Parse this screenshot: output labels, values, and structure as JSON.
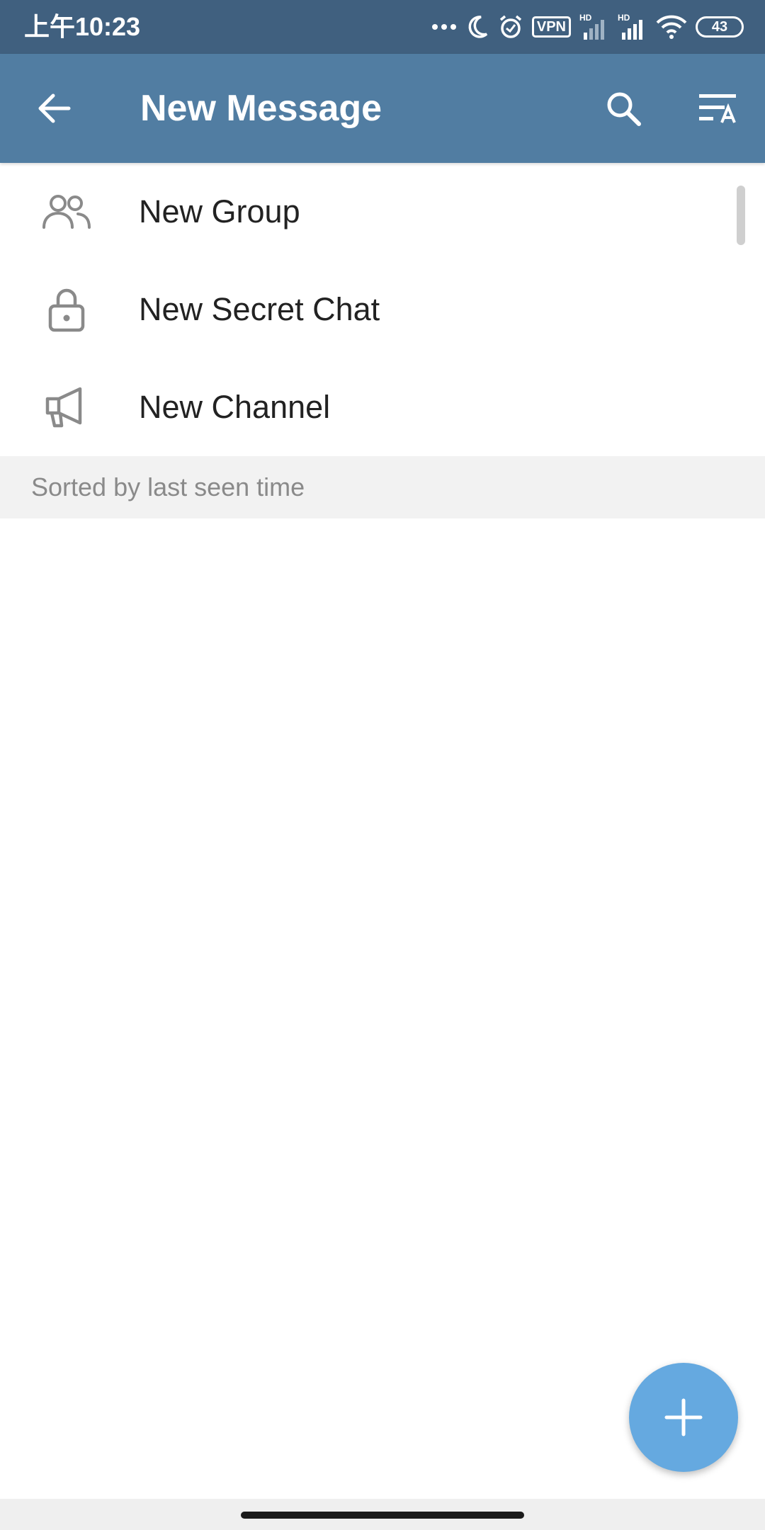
{
  "status_bar": {
    "time": "上午10:23",
    "vpn_label": "VPN",
    "signal_badge_1": "HD",
    "signal_badge_2": "HD",
    "battery_level": "43",
    "icons": [
      "more-dots-icon",
      "moon-icon",
      "alarm-icon",
      "vpn-icon",
      "signal-hd-icon",
      "signal-hd-icon",
      "wifi-icon",
      "battery-icon"
    ]
  },
  "app_bar": {
    "title": "New Message",
    "back_icon": "arrow-left-icon",
    "search_icon": "search-icon",
    "sort_icon": "sort-alpha-icon"
  },
  "actions": [
    {
      "label": "New Group",
      "icon": "group-icon"
    },
    {
      "label": "New Secret Chat",
      "icon": "lock-icon"
    },
    {
      "label": "New Channel",
      "icon": "megaphone-icon"
    }
  ],
  "section_header": "Sorted by last seen time",
  "fab": {
    "icon": "plus-icon"
  },
  "colors": {
    "status_bar": "#40607f",
    "app_bar": "#517da2",
    "fab": "#65a9e0",
    "section_bg": "#f2f2f2",
    "icon_gray": "#8a8a8a"
  }
}
